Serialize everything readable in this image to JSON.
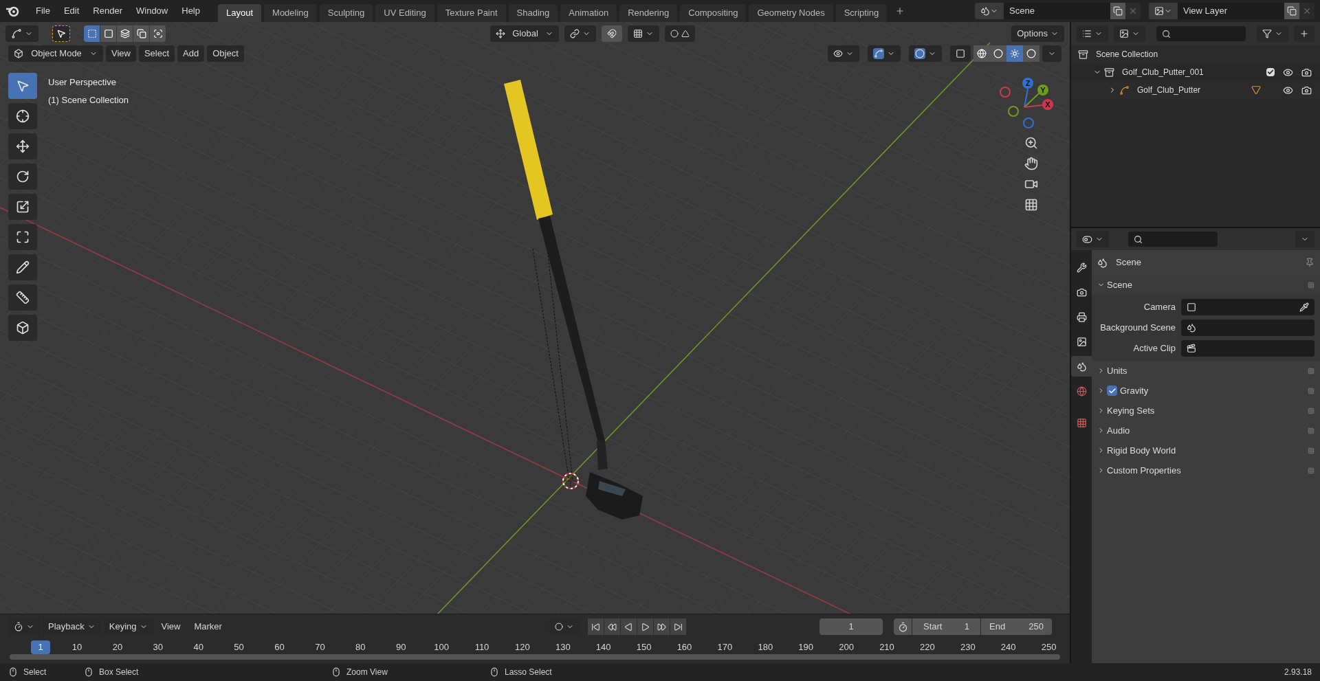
{
  "topbar": {
    "menus": [
      "File",
      "Edit",
      "Render",
      "Window",
      "Help"
    ],
    "workspaces": [
      {
        "label": "Layout",
        "selected": true
      },
      {
        "label": "Modeling",
        "selected": false
      },
      {
        "label": "Sculpting",
        "selected": false
      },
      {
        "label": "UV Editing",
        "selected": false
      },
      {
        "label": "Texture Paint",
        "selected": false
      },
      {
        "label": "Shading",
        "selected": false
      },
      {
        "label": "Animation",
        "selected": false
      },
      {
        "label": "Rendering",
        "selected": false
      },
      {
        "label": "Compositing",
        "selected": false
      },
      {
        "label": "Geometry Nodes",
        "selected": false
      },
      {
        "label": "Scripting",
        "selected": false
      }
    ],
    "scene": "Scene",
    "view_layer": "View Layer"
  },
  "viewport": {
    "select_modes": [
      {
        "selected": true
      },
      {
        "selected": false
      },
      {
        "selected": false
      },
      {
        "selected": false
      },
      {
        "selected": false
      }
    ],
    "gizmos_on": true,
    "overlays_on": true,
    "orientation": "Global",
    "options": "Options",
    "mode": "Object Mode",
    "menus": [
      "View",
      "Select",
      "Add",
      "Object"
    ],
    "shading_modes": [
      {
        "selected": false
      },
      {
        "selected": false
      },
      {
        "selected": true
      },
      {
        "selected": false
      }
    ],
    "overlay_text": [
      "User Perspective",
      "(1) Scene Collection"
    ],
    "tools": [
      {
        "selected": true
      },
      {
        "selected": false
      },
      {
        "selected": false
      },
      {
        "selected": false
      },
      {
        "selected": false
      },
      {
        "selected": false
      },
      {
        "selected": false
      },
      {
        "selected": false
      },
      {
        "selected": false
      }
    ],
    "gizmo_axes": [
      {
        "label": "Z",
        "color": "#2f6fd6"
      },
      {
        "label": "Y",
        "color": "#6a9c1f"
      },
      {
        "label": "X",
        "color": "#d2354b"
      }
    ]
  },
  "outliner": {
    "items": [
      {
        "label": "Scene Collection",
        "children": [
          {
            "label": "Golf_Club_Putter_001",
            "expanded": true,
            "checked": true,
            "children": [
              {
                "label": "Golf_Club_Putter",
                "expanded": false
              }
            ]
          }
        ]
      }
    ]
  },
  "properties": {
    "tabs": [
      {
        "selected": false
      },
      {
        "selected": false
      },
      {
        "selected": false
      },
      {
        "selected": false
      },
      {
        "selected": true
      },
      {
        "selected": false
      },
      {
        "selected": false
      }
    ],
    "context": "Scene",
    "panels": [
      {
        "title": "Scene",
        "kind": "plain",
        "expanded": true,
        "fields": [
          {
            "label": "Camera"
          },
          {
            "label": "Background Scene"
          },
          {
            "label": "Active Clip"
          }
        ]
      },
      {
        "title": "Units",
        "kind": "plain",
        "expanded": false
      },
      {
        "title": "Gravity",
        "kind": "checkbox",
        "checked": true,
        "expanded": false
      },
      {
        "title": "Keying Sets",
        "kind": "plain",
        "expanded": false
      },
      {
        "title": "Audio",
        "kind": "plain",
        "expanded": false
      },
      {
        "title": "Rigid Body World",
        "kind": "plain",
        "expanded": false
      },
      {
        "title": "Custom Properties",
        "kind": "plain",
        "expanded": false
      }
    ]
  },
  "timeline": {
    "menus": [
      {
        "label": "Playback",
        "dropdown": true
      },
      {
        "label": "Keying",
        "dropdown": true
      },
      {
        "label": "View",
        "dropdown": false
      },
      {
        "label": "Marker",
        "dropdown": false
      }
    ],
    "current_frame": "1",
    "start_label": "Start",
    "start": "1",
    "end_label": "End",
    "end": "250",
    "ruler": [
      {
        "label": "1",
        "selected": true
      },
      {
        "label": "10",
        "selected": false
      },
      {
        "label": "20",
        "selected": false
      },
      {
        "label": "30",
        "selected": false
      },
      {
        "label": "40",
        "selected": false
      },
      {
        "label": "50",
        "selected": false
      },
      {
        "label": "60",
        "selected": false
      },
      {
        "label": "70",
        "selected": false
      },
      {
        "label": "80",
        "selected": false
      },
      {
        "label": "90",
        "selected": false
      },
      {
        "label": "100",
        "selected": false
      },
      {
        "label": "110",
        "selected": false
      },
      {
        "label": "120",
        "selected": false
      },
      {
        "label": "130",
        "selected": false
      },
      {
        "label": "140",
        "selected": false
      },
      {
        "label": "150",
        "selected": false
      },
      {
        "label": "160",
        "selected": false
      },
      {
        "label": "170",
        "selected": false
      },
      {
        "label": "180",
        "selected": false
      },
      {
        "label": "190",
        "selected": false
      },
      {
        "label": "200",
        "selected": false
      },
      {
        "label": "210",
        "selected": false
      },
      {
        "label": "220",
        "selected": false
      },
      {
        "label": "230",
        "selected": false
      },
      {
        "label": "240",
        "selected": false
      },
      {
        "label": "250",
        "selected": false
      }
    ]
  },
  "status_bar": {
    "hints": [
      "Select",
      "Box Select",
      "Zoom View",
      "Lasso Select"
    ],
    "version": "2.93.18"
  }
}
